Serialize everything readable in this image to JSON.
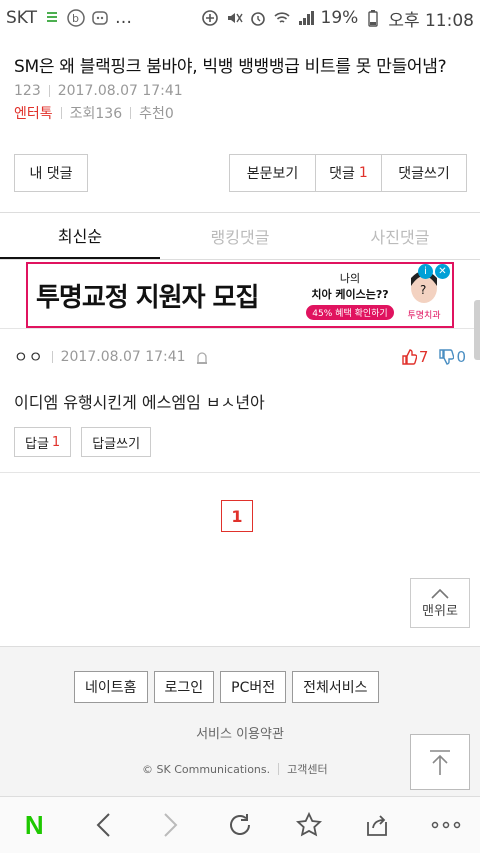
{
  "status_bar": {
    "carrier": "SKT",
    "battery": "19%",
    "time": "오후 11:08"
  },
  "article": {
    "title": "SM은 왜 블랙핑크 붐바야, 빅뱅 뱅뱅뱅급 비트를 못 만들어냄?",
    "author": "123",
    "datetime": "2017.08.07 17:41",
    "category": "엔터톡",
    "views": "조회136",
    "recommend": "추천0"
  },
  "action_buttons": {
    "my_comments": "내 댓글",
    "view_body": "본문보기",
    "comments_label": "댓글",
    "comments_count": "1",
    "write_comment": "댓글쓰기"
  },
  "tabs": [
    {
      "label": "최신순",
      "active": true
    },
    {
      "label": "랭킹댓글",
      "active": false
    },
    {
      "label": "사진댓글",
      "active": false
    }
  ],
  "ad": {
    "main_text": "투명교정 지원자 모집",
    "mid_line1": "나의",
    "mid_line2": "치아 케이스는??",
    "mid_pill": "45% 혜택 확인하기",
    "right_text": "투명치과",
    "badge_info": "i",
    "badge_close": "✕"
  },
  "comment": {
    "user": "ㅇㅇ",
    "datetime": "2017.08.07 17:41",
    "up_count": "7",
    "down_count": "0",
    "text": "이디엠 유행시킨게 에스엠임 ㅂㅅ년아",
    "reply_label": "답글",
    "reply_count": "1",
    "write_reply": "답글쓰기"
  },
  "pagination": {
    "current": "1"
  },
  "top_button": {
    "label": "맨위로"
  },
  "footer": {
    "links": [
      "네이트홈",
      "로그인",
      "PC버전",
      "전체서비스"
    ],
    "terms": "서비스 이용약관",
    "copyright": "© SK Communications.",
    "support": "고객센터"
  },
  "browser": {
    "logo": "N"
  },
  "colors": {
    "accent_red": "#e0312b",
    "ad_pink": "#e0135f",
    "naver_green": "#1ec800"
  }
}
